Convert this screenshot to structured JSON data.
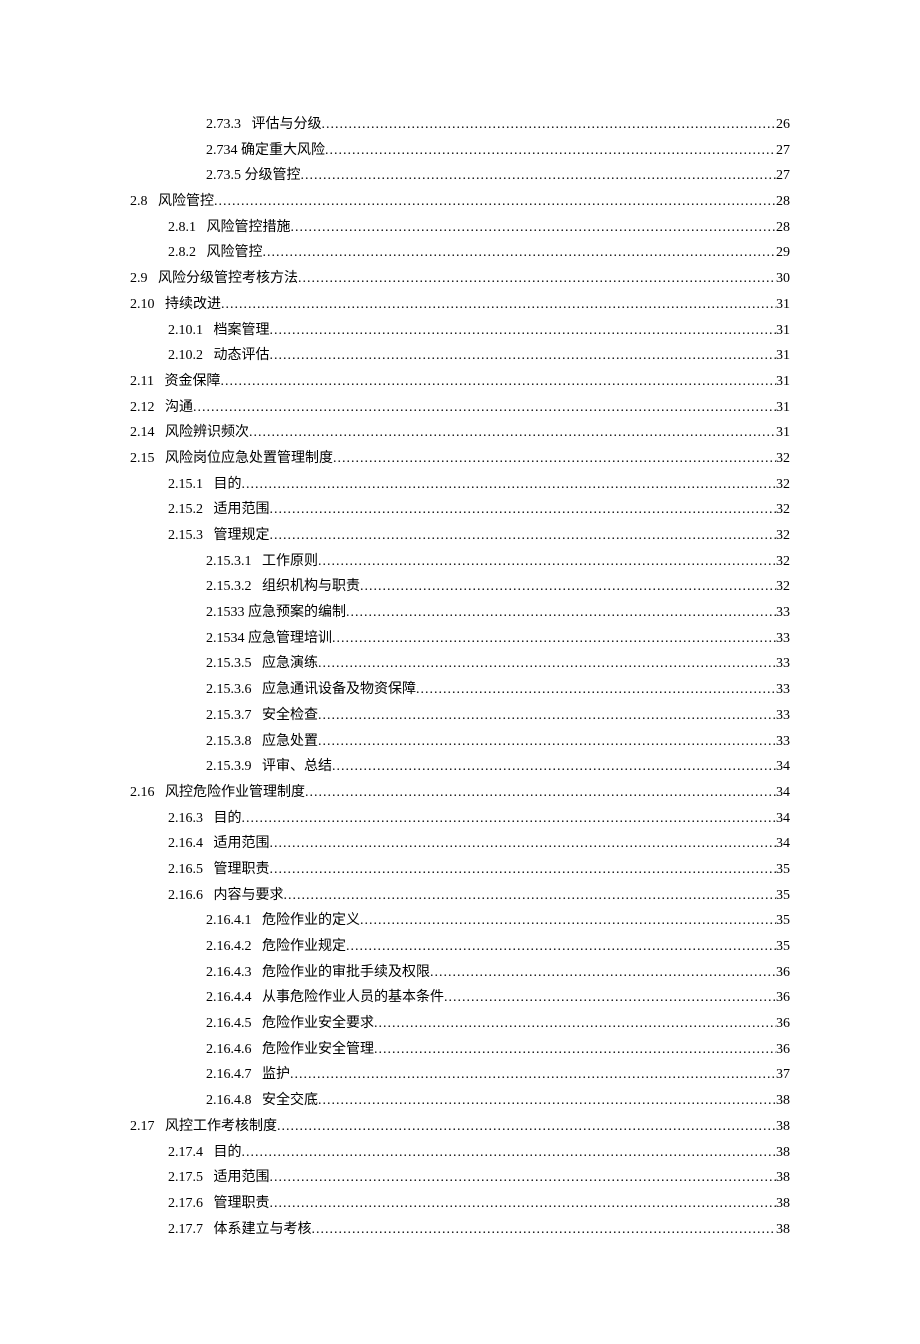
{
  "toc": [
    {
      "indent": 2,
      "num": "2.73.3",
      "sep": "   ",
      "title": "评估与分级",
      "page": "26"
    },
    {
      "indent": 2,
      "num": "2.734",
      "sep": " ",
      "title": "确定重大风险",
      "page": "27"
    },
    {
      "indent": 2,
      "num": "2.73.5",
      "sep": " ",
      "title": "分级管控",
      "page": "27"
    },
    {
      "indent": 0,
      "num": "2.8",
      "sep": "   ",
      "title": "风险管控",
      "page": "28"
    },
    {
      "indent": 1,
      "num": "2.8.1",
      "sep": "   ",
      "title": "风险管控措施",
      "page": "28"
    },
    {
      "indent": 1,
      "num": "2.8.2",
      "sep": "   ",
      "title": "风险管控",
      "page": "29"
    },
    {
      "indent": 0,
      "num": "2.9",
      "sep": "   ",
      "title": "风险分级管控考核方法",
      "page": "30"
    },
    {
      "indent": 0,
      "num": "2.10",
      "sep": "   ",
      "title": "持续改进",
      "page": "31"
    },
    {
      "indent": 1,
      "num": "2.10.1",
      "sep": "   ",
      "title": "档案管理",
      "page": "31"
    },
    {
      "indent": 1,
      "num": "2.10.2",
      "sep": "   ",
      "title": "动态评估",
      "page": "31"
    },
    {
      "indent": 0,
      "num": "2.11",
      "sep": "   ",
      "title": "资金保障",
      "page": "31"
    },
    {
      "indent": 0,
      "num": "2.12",
      "sep": "   ",
      "title": "沟通",
      "page": "31"
    },
    {
      "indent": 0,
      "num": "2.14",
      "sep": "   ",
      "title": "风险辨识频次",
      "page": "31"
    },
    {
      "indent": 0,
      "num": "2.15",
      "sep": "   ",
      "title": "风险岗位应急处置管理制度",
      "page": "32"
    },
    {
      "indent": 1,
      "num": "2.15.1",
      "sep": "   ",
      "title": "目的",
      "page": "32"
    },
    {
      "indent": 1,
      "num": "2.15.2",
      "sep": "   ",
      "title": "适用范围",
      "page": "32"
    },
    {
      "indent": 1,
      "num": "2.15.3",
      "sep": "   ",
      "title": "管理规定",
      "page": "32"
    },
    {
      "indent": 2,
      "num": "2.15.3.1",
      "sep": "   ",
      "title": "工作原则",
      "page": "32"
    },
    {
      "indent": 2,
      "num": "2.15.3.2",
      "sep": "   ",
      "title": "组织机构与职责",
      "page": "32"
    },
    {
      "indent": 2,
      "num": "2.1533",
      "sep": " ",
      "title": "应急预案的编制",
      "page": "33"
    },
    {
      "indent": 2,
      "num": "2.1534",
      "sep": " ",
      "title": "应急管理培训",
      "page": "33"
    },
    {
      "indent": 2,
      "num": "2.15.3.5",
      "sep": "   ",
      "title": "应急演练",
      "page": "33"
    },
    {
      "indent": 2,
      "num": "2.15.3.6",
      "sep": "   ",
      "title": "应急通讯设备及物资保障",
      "page": "33"
    },
    {
      "indent": 2,
      "num": "2.15.3.7",
      "sep": "   ",
      "title": "安全检查",
      "page": "33"
    },
    {
      "indent": 2,
      "num": "2.15.3.8",
      "sep": "   ",
      "title": "应急处置",
      "page": "33"
    },
    {
      "indent": 2,
      "num": "2.15.3.9",
      "sep": "   ",
      "title": "评审、总结",
      "page": "34"
    },
    {
      "indent": 0,
      "num": "2.16",
      "sep": "   ",
      "title": "风控危险作业管理制度",
      "page": "34"
    },
    {
      "indent": 1,
      "num": "2.16.3",
      "sep": "   ",
      "title": "目的",
      "page": "34"
    },
    {
      "indent": 1,
      "num": "2.16.4",
      "sep": "   ",
      "title": "适用范围",
      "page": "34"
    },
    {
      "indent": 1,
      "num": "2.16.5",
      "sep": "   ",
      "title": "管理职责",
      "page": "35"
    },
    {
      "indent": 1,
      "num": "2.16.6",
      "sep": "   ",
      "title": "内容与要求",
      "page": "35"
    },
    {
      "indent": 2,
      "num": "2.16.4.1",
      "sep": "   ",
      "title": "危险作业的定义",
      "page": "35"
    },
    {
      "indent": 2,
      "num": "2.16.4.2",
      "sep": "   ",
      "title": "危险作业规定",
      "page": "35"
    },
    {
      "indent": 2,
      "num": "2.16.4.3",
      "sep": "   ",
      "title": "危险作业的审批手续及权限",
      "page": "36"
    },
    {
      "indent": 2,
      "num": "2.16.4.4",
      "sep": "   ",
      "title": "从事危险作业人员的基本条件",
      "page": "36"
    },
    {
      "indent": 2,
      "num": "2.16.4.5",
      "sep": "   ",
      "title": "危险作业安全要求",
      "page": "36"
    },
    {
      "indent": 2,
      "num": "2.16.4.6",
      "sep": "   ",
      "title": "危险作业安全管理",
      "page": "36"
    },
    {
      "indent": 2,
      "num": "2.16.4.7",
      "sep": "   ",
      "title": "监护",
      "page": "37"
    },
    {
      "indent": 2,
      "num": "2.16.4.8",
      "sep": "   ",
      "title": "安全交底",
      "page": "38"
    },
    {
      "indent": 0,
      "num": "2.17",
      "sep": "   ",
      "title": "风控工作考核制度",
      "page": "38"
    },
    {
      "indent": 1,
      "num": "2.17.4",
      "sep": "   ",
      "title": "目的",
      "page": "38"
    },
    {
      "indent": 1,
      "num": "2.17.5",
      "sep": "   ",
      "title": "适用范围",
      "page": "38"
    },
    {
      "indent": 1,
      "num": "2.17.6",
      "sep": "   ",
      "title": "管理职责",
      "page": "38"
    },
    {
      "indent": 1,
      "num": "2.17.7",
      "sep": "   ",
      "title": "体系建立与考核",
      "page": "38"
    }
  ]
}
